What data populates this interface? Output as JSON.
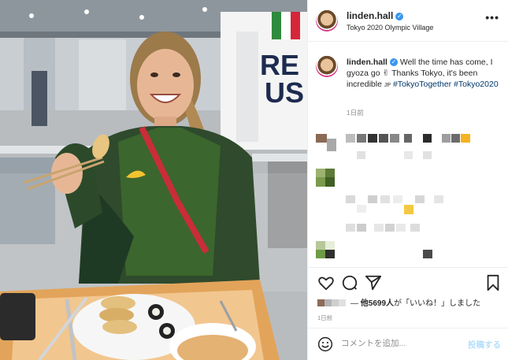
{
  "post": {
    "username": "linden.hall",
    "location": "Tokyo 2020 Olympic Village",
    "more_icon": "more-horizontal-icon",
    "photo_sign_text_1": "RE",
    "photo_sign_text_2": "US"
  },
  "caption": {
    "username": "linden.hall",
    "text_1": "Well the time has come, I gyoza go ",
    "emoji_1": "✌",
    "text_2": " Thanks Tokyo, it's been incredible ",
    "emoji_2": "JP",
    "tag_1": "#TokyoTogether",
    "tag_2": "#Tokyo2020",
    "date": "1日前"
  },
  "engagement": {
    "likes_prefix": "— ",
    "likes_bold": "他5699人",
    "likes_suffix": "が「いいね！」しました",
    "date": "1日前"
  },
  "composer": {
    "placeholder": "コメントを追加...",
    "post_label": "投稿する"
  },
  "colors": {
    "accent": "#3897f0",
    "hashtag": "#00376b",
    "post_disabled": "#b2dffc",
    "muted": "#8e8e8e"
  }
}
